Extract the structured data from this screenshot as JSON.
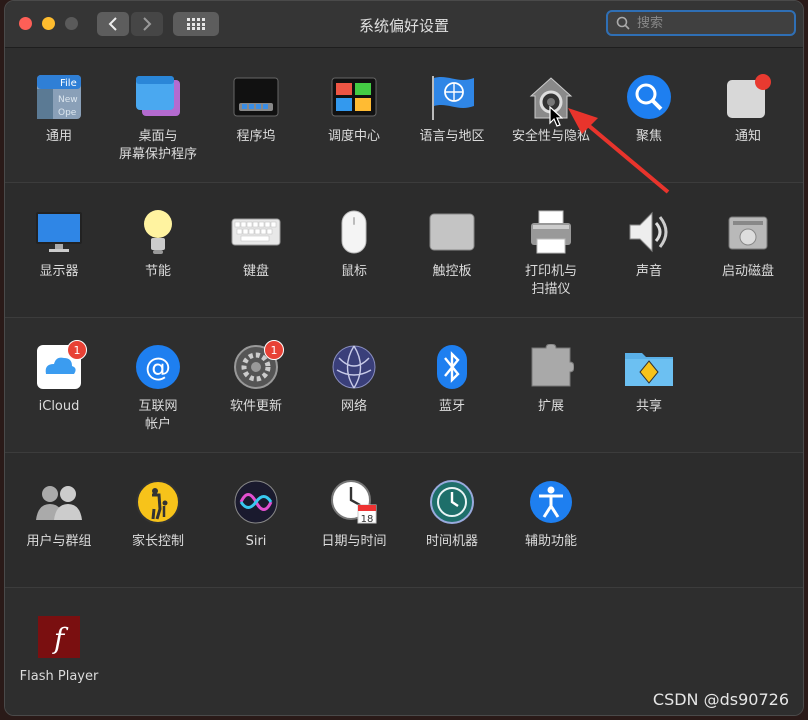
{
  "window": {
    "title": "系统偏好设置",
    "search_placeholder": "搜索"
  },
  "rows": [
    [
      {
        "label": "通用",
        "icon": "general-icon"
      },
      {
        "label": "桌面与\n屏幕保护程序",
        "icon": "desktop-screensaver-icon"
      },
      {
        "label": "程序坞",
        "icon": "dock-icon"
      },
      {
        "label": "调度中心",
        "icon": "mission-control-icon"
      },
      {
        "label": "语言与地区",
        "icon": "language-region-icon"
      },
      {
        "label": "安全性与隐私",
        "icon": "security-privacy-icon"
      },
      {
        "label": "聚焦",
        "icon": "spotlight-icon"
      },
      {
        "label": "通知",
        "icon": "notifications-icon"
      }
    ],
    [
      {
        "label": "显示器",
        "icon": "displays-icon"
      },
      {
        "label": "节能",
        "icon": "energy-saver-icon"
      },
      {
        "label": "键盘",
        "icon": "keyboard-icon"
      },
      {
        "label": "鼠标",
        "icon": "mouse-icon"
      },
      {
        "label": "触控板",
        "icon": "trackpad-icon"
      },
      {
        "label": "打印机与\n扫描仪",
        "icon": "printer-icon"
      },
      {
        "label": "声音",
        "icon": "sound-icon"
      },
      {
        "label": "启动磁盘",
        "icon": "startup-disk-icon"
      }
    ],
    [
      {
        "label": "iCloud",
        "icon": "icloud-icon",
        "badge": "1"
      },
      {
        "label": "互联网\n帐户",
        "icon": "internet-accounts-icon"
      },
      {
        "label": "软件更新",
        "icon": "software-update-icon",
        "badge": "1"
      },
      {
        "label": "网络",
        "icon": "network-icon"
      },
      {
        "label": "蓝牙",
        "icon": "bluetooth-icon"
      },
      {
        "label": "扩展",
        "icon": "extensions-icon"
      },
      {
        "label": "共享",
        "icon": "sharing-icon"
      }
    ],
    [
      {
        "label": "用户与群组",
        "icon": "users-groups-icon"
      },
      {
        "label": "家长控制",
        "icon": "parental-controls-icon"
      },
      {
        "label": "Siri",
        "icon": "siri-icon"
      },
      {
        "label": "日期与时间",
        "icon": "date-time-icon"
      },
      {
        "label": "时间机器",
        "icon": "time-machine-icon"
      },
      {
        "label": "辅助功能",
        "icon": "accessibility-icon"
      }
    ],
    [
      {
        "label": "Flash Player",
        "icon": "flash-player-icon"
      }
    ]
  ],
  "watermark": "CSDN @ds90726"
}
